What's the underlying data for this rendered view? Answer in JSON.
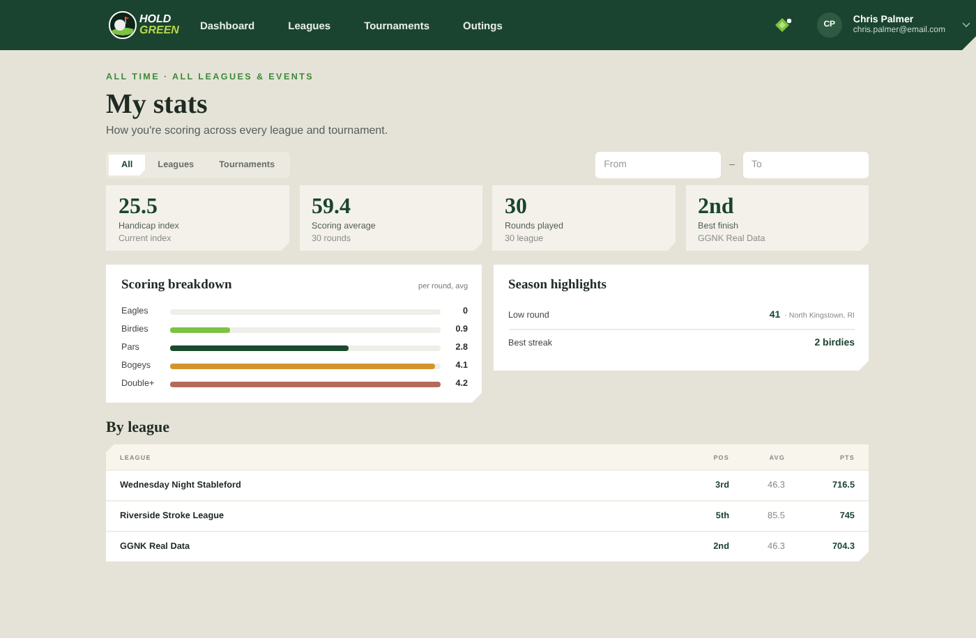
{
  "header": {
    "logo": {
      "line_1": "HOLD",
      "line_2": "GREEN"
    },
    "nav": [
      {
        "label": "Dashboard"
      },
      {
        "label": "Leagues"
      },
      {
        "label": "Tournaments"
      },
      {
        "label": "Outings"
      }
    ],
    "user": {
      "initials": "CP",
      "name": "Chris Palmer",
      "email": "chris.palmer@email.com"
    }
  },
  "eyebrow": "ALL TIME · ALL LEAGUES & EVENTS",
  "title": "My stats",
  "subtitle": "How you're scoring across every league and tournament.",
  "filters": [
    {
      "label": "All",
      "selected": true
    },
    {
      "label": "Leagues",
      "selected": false
    },
    {
      "label": "Tournaments",
      "selected": false
    }
  ],
  "date_range": {
    "from": {
      "placeholder": "From"
    },
    "separator": "–",
    "to": {
      "placeholder": "To"
    }
  },
  "stats": [
    {
      "value": "25.5",
      "label": "Handicap index",
      "note": "Current index"
    },
    {
      "value": "59.4",
      "label": "Scoring average",
      "note": "30 rounds"
    },
    {
      "value": "30",
      "label": "Rounds played",
      "note": "30 league"
    },
    {
      "value": "2nd",
      "label": "Best finish",
      "note": "GGNK Real Data"
    }
  ],
  "breakdown": {
    "title": "Scoring breakdown",
    "hint": "per round, avg",
    "rows": [
      {
        "label": "Eagles",
        "value": "0"
      },
      {
        "label": "Birdies",
        "level": 0.22,
        "color": "#7dc242",
        "value": "0.9"
      },
      {
        "label": "Pars",
        "level": 0.66,
        "color": "#1b4a2f",
        "value": "2.8"
      },
      {
        "label": "Bogeys",
        "level": 0.98,
        "color": "#d3952b",
        "value": "4.1"
      },
      {
        "label": "Double+",
        "level": 1,
        "color": "#b56a5e",
        "value": "4.2"
      }
    ]
  },
  "highlights": {
    "title": "Season highlights",
    "rows": [
      {
        "label": "Low round",
        "value": "41",
        "detail": "· North Kingstown, RI"
      },
      {
        "label": "Best streak",
        "value": "2 birdies"
      }
    ]
  },
  "by_league": {
    "title": "By league",
    "columns": [
      "LEAGUE",
      "POS",
      "AVG",
      "PTS"
    ],
    "rows": [
      [
        "Wednesday Night Stableford",
        "3rd",
        "46.3",
        "716.5"
      ],
      [
        "Riverside Stroke League",
        "5th",
        "85.5",
        "745"
      ],
      [
        "GGNK Real Data",
        "2nd",
        "46.3",
        "704.3"
      ]
    ]
  }
}
